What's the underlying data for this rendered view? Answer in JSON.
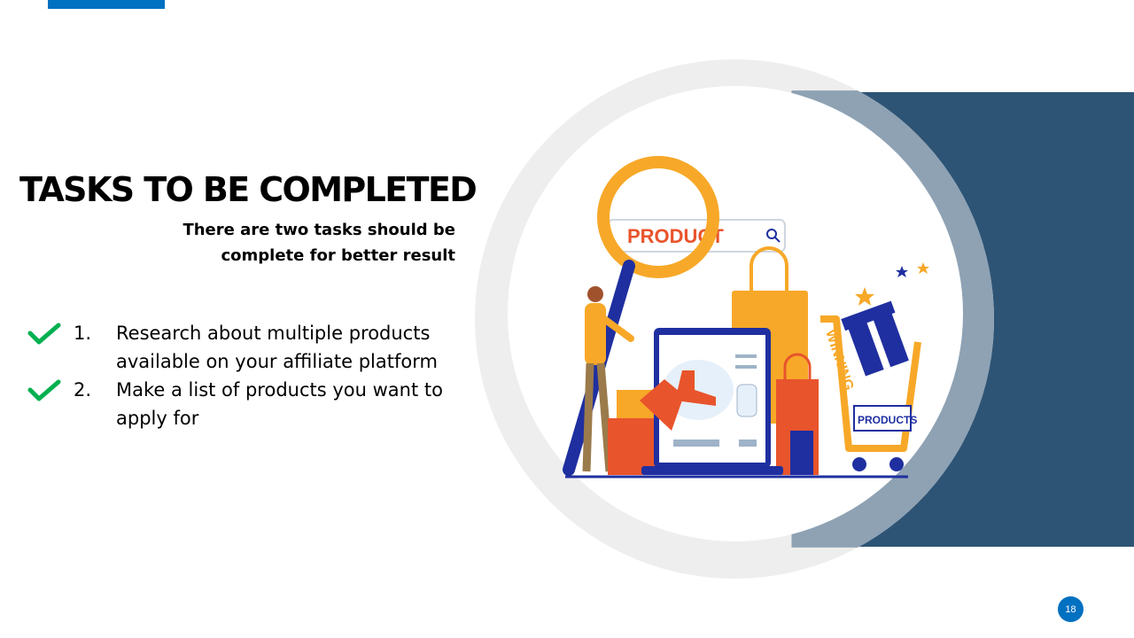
{
  "slide": {
    "title": "TASKS TO BE COMPLETED",
    "subtitle_line1": "There are two tasks should be",
    "subtitle_line2": "complete for better result",
    "page_number": "18"
  },
  "tasks": [
    {
      "number": "1.",
      "line1": "Research about multiple products",
      "line2": "available on your affiliate platform"
    },
    {
      "number": "2.",
      "line1": "Make a list of products you want to",
      "line2": "apply for"
    }
  ],
  "illustration": {
    "search_label": "PRODUCT",
    "cart_banner": "WINNING",
    "cart_label": "PRODUCTS"
  },
  "colors": {
    "accent_blue": "#0070c0",
    "panel_navy": "#2e5475",
    "check_green": "#00b050",
    "ring_gray": "#eeeeee",
    "illustration_orange": "#f7a828",
    "illustration_red": "#e8542c",
    "illustration_navy": "#1f2fa0"
  },
  "icons": [
    "check-icon",
    "search-icon",
    "magnifier-icon",
    "gift-icon",
    "star-icon"
  ]
}
